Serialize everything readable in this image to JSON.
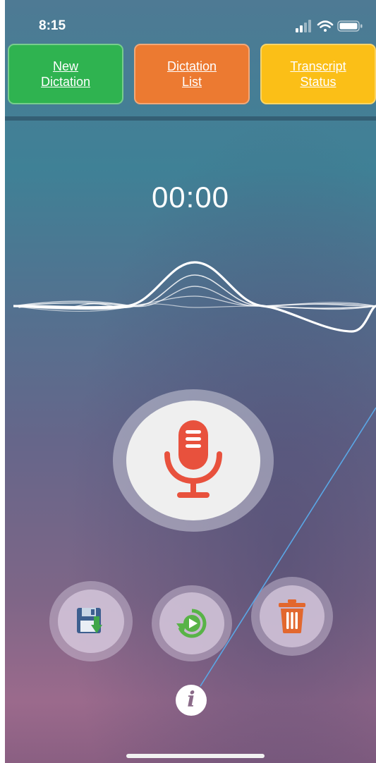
{
  "status_bar": {
    "time": "8:15",
    "icons": [
      "signal-icon",
      "wifi-icon",
      "battery-icon"
    ]
  },
  "nav": {
    "new_dictation": {
      "line1": "New",
      "line2": "Dictation",
      "color": "#2fb350"
    },
    "dictation_list": {
      "line1": "Dictation",
      "line2": "List",
      "color": "#ec7a31"
    },
    "transcript_status": {
      "line1": "Transcript",
      "line2": "Status",
      "color": "#fbbf17"
    }
  },
  "recorder": {
    "timer": "00:00",
    "mic_icon": "microphone-icon",
    "mic_color": "#e8513d"
  },
  "actions": [
    {
      "name": "save",
      "icon": "floppy-disk-icon"
    },
    {
      "name": "play",
      "icon": "replay-play-icon"
    },
    {
      "name": "delete",
      "icon": "trash-icon"
    }
  ],
  "info": {
    "label": "i",
    "icon": "info-icon"
  }
}
